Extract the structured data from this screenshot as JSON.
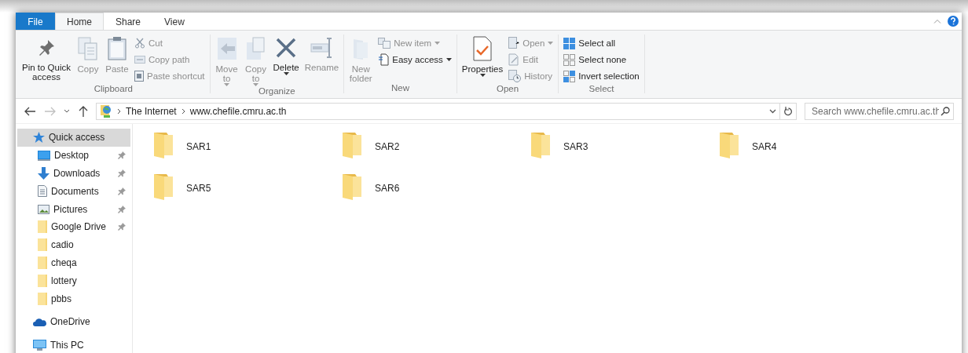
{
  "tabs": [
    {
      "label": "File",
      "kind": "file",
      "selected": false
    },
    {
      "label": "Home",
      "kind": "tab",
      "selected": true
    },
    {
      "label": "Share",
      "kind": "tab",
      "selected": false
    },
    {
      "label": "View",
      "kind": "tab",
      "selected": false
    }
  ],
  "ribbon_groups": [
    {
      "label": "Clipboard",
      "items": [
        {
          "kind": "large",
          "label": "Pin to Quick\naccess",
          "disabled": false,
          "dropdown": false
        },
        {
          "kind": "large",
          "label": "Copy",
          "disabled": true,
          "dropdown": false
        },
        {
          "kind": "large",
          "label": "Paste",
          "disabled": true,
          "dropdown": false
        },
        {
          "kind": "small",
          "label": "Cut",
          "disabled": true,
          "dropdown": false
        },
        {
          "kind": "small",
          "label": "Copy path",
          "disabled": true,
          "dropdown": false
        },
        {
          "kind": "small",
          "label": "Paste shortcut",
          "disabled": true,
          "dropdown": false
        }
      ]
    },
    {
      "label": "Organize",
      "items": [
        {
          "kind": "large",
          "label": "Move\nto",
          "disabled": true,
          "dropdown": true
        },
        {
          "kind": "large",
          "label": "Copy\nto",
          "disabled": true,
          "dropdown": true
        },
        {
          "kind": "large",
          "label": "Delete",
          "disabled": false,
          "dropdown": true
        },
        {
          "kind": "large",
          "label": "Rename",
          "disabled": true,
          "dropdown": false
        }
      ]
    },
    {
      "label": "New",
      "items": [
        {
          "kind": "large",
          "label": "New\nfolder",
          "disabled": true,
          "dropdown": false
        },
        {
          "kind": "small",
          "label": "New item",
          "disabled": true,
          "dropdown": true
        },
        {
          "kind": "small",
          "label": "Easy access",
          "disabled": false,
          "dropdown": true
        }
      ]
    },
    {
      "label": "Open",
      "items": [
        {
          "kind": "large",
          "label": "Properties",
          "disabled": false,
          "dropdown": true
        },
        {
          "kind": "small",
          "label": "Open",
          "disabled": true,
          "dropdown": true
        },
        {
          "kind": "small",
          "label": "Edit",
          "disabled": true,
          "dropdown": false
        },
        {
          "kind": "small",
          "label": "History",
          "disabled": true,
          "dropdown": false
        }
      ]
    },
    {
      "label": "Select",
      "items": [
        {
          "kind": "small",
          "label": "Select all",
          "disabled": false,
          "dropdown": false
        },
        {
          "kind": "small",
          "label": "Select none",
          "disabled": false,
          "dropdown": false
        },
        {
          "kind": "small",
          "label": "Invert selection",
          "disabled": false,
          "dropdown": false
        }
      ]
    }
  ],
  "address_bar": {
    "crumbs": [
      "The Internet",
      "www.chefile.cmru.ac.th"
    ]
  },
  "search": {
    "placeholder": "Search www.chefile.cmru.ac.th"
  },
  "sidebar": {
    "items": [
      {
        "label": "Quick access",
        "kind": "quick",
        "pinned": false,
        "selected": true,
        "children": [
          {
            "label": "Desktop",
            "kind": "desktop",
            "pinned": true,
            "selected": false
          },
          {
            "label": "Downloads",
            "kind": "downloads",
            "pinned": true,
            "selected": false
          },
          {
            "label": "Documents",
            "kind": "documents",
            "pinned": true,
            "selected": false
          },
          {
            "label": "Pictures",
            "kind": "pictures",
            "pinned": true,
            "selected": false
          },
          {
            "label": "Google Drive",
            "kind": "folder",
            "pinned": true,
            "selected": false
          },
          {
            "label": "cadio",
            "kind": "folder",
            "pinned": false,
            "selected": false
          },
          {
            "label": "cheqa",
            "kind": "folder",
            "pinned": false,
            "selected": false
          },
          {
            "label": "lottery",
            "kind": "folder",
            "pinned": false,
            "selected": false
          },
          {
            "label": "pbbs",
            "kind": "folder",
            "pinned": false,
            "selected": false
          }
        ]
      },
      {
        "label": "OneDrive",
        "kind": "onedrive",
        "pinned": false,
        "selected": false
      },
      {
        "label": "This PC",
        "kind": "pc",
        "pinned": false,
        "selected": false
      }
    ]
  },
  "folders": [
    {
      "name": "SAR1"
    },
    {
      "name": "SAR2"
    },
    {
      "name": "SAR3"
    },
    {
      "name": "SAR4"
    },
    {
      "name": "SAR5"
    },
    {
      "name": "SAR6"
    }
  ]
}
